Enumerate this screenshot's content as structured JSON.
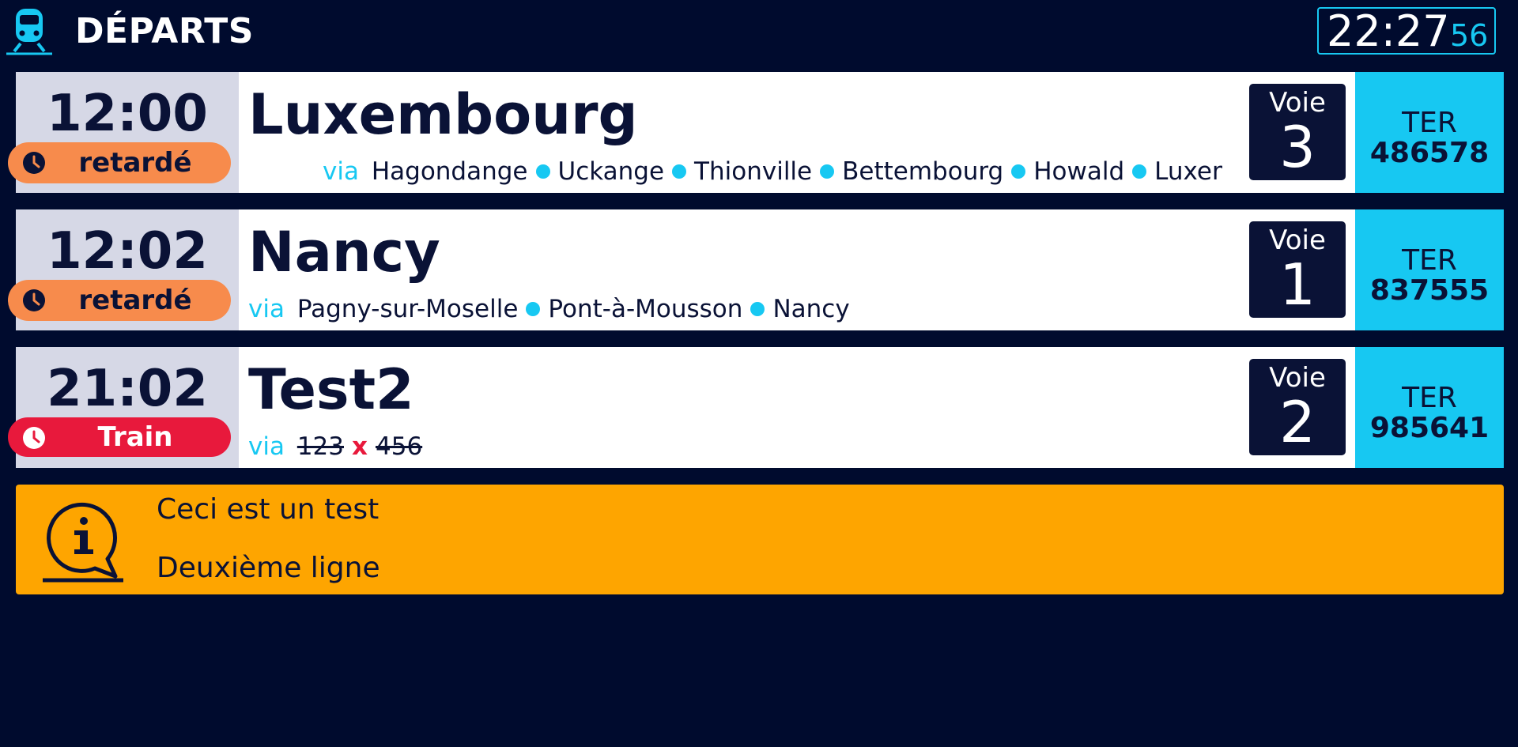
{
  "header": {
    "title": "DÉPARTS",
    "clock_hm": "22:27",
    "clock_s": "56",
    "train_icon": "train-icon"
  },
  "departures": [
    {
      "time": "12:00",
      "status": "retardé",
      "status_kind": "delay",
      "destination": "Luxembourg",
      "via_label": "via",
      "stops": [
        "Hagondange",
        "Uckange",
        "Thionville",
        "Bettembourg",
        "Howald",
        "Luxem"
      ],
      "platform_label": "Voie",
      "platform": "3",
      "train_type": "TER",
      "train_number": "486578"
    },
    {
      "time": "12:02",
      "status": "retardé",
      "status_kind": "delay",
      "destination": "Nancy",
      "via_label": "via",
      "stops": [
        "Pagny-sur-Moselle",
        "Pont-à-Mousson",
        "Nancy"
      ],
      "platform_label": "Voie",
      "platform": "1",
      "train_type": "TER",
      "train_number": "837555"
    },
    {
      "time": "21:02",
      "status": "Train",
      "status_kind": "cancel",
      "destination": "Test2",
      "via_label": "via",
      "struck_stops": [
        "123",
        "456"
      ],
      "separator": "x",
      "platform_label": "Voie",
      "platform": "2",
      "train_type": "TER",
      "train_number": "985641"
    }
  ],
  "info": {
    "icon": "info-speech-bubble-icon",
    "line1": "Ceci est un test",
    "line2": "Deuxième ligne"
  },
  "colors": {
    "background": "#000b2e",
    "accent": "#17c8f2",
    "delay": "#f78b4c",
    "cancel": "#e8193c",
    "info": "#fea500"
  }
}
